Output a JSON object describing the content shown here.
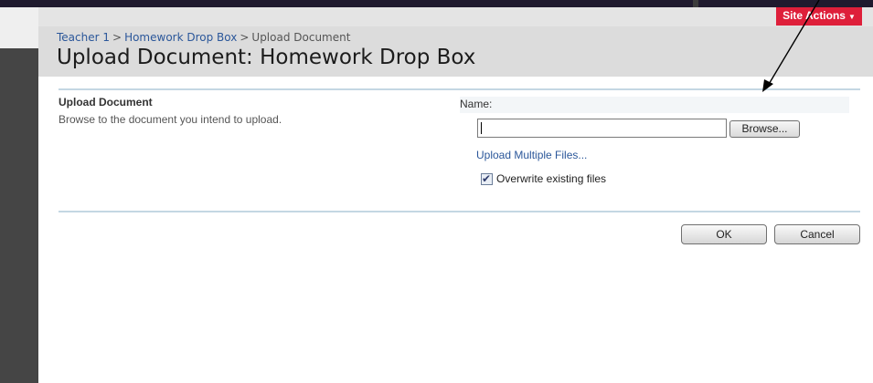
{
  "site_actions": {
    "label": "Site Actions",
    "caret": "▼"
  },
  "breadcrumb": {
    "items": [
      "Teacher 1",
      "Homework Drop Box",
      "Upload Document"
    ],
    "separator": ">"
  },
  "page": {
    "title": "Upload Document: Homework Drop Box"
  },
  "section": {
    "title": "Upload Document",
    "description": "Browse to the document you intend to upload."
  },
  "form": {
    "name_label": "Name:",
    "file_value": "",
    "browse_label": "Browse...",
    "upload_multiple_label": "Upload Multiple Files...",
    "overwrite_label": "Overwrite existing files",
    "overwrite_checked": true
  },
  "actions": {
    "ok_label": "OK",
    "cancel_label": "Cancel"
  },
  "colors": {
    "site_actions_bg": "#de1f3a",
    "link": "#2b579a",
    "rule": "#c4d7e3",
    "header_band": "#dcdcdc"
  },
  "icons": {
    "checkbox": "checkmark-icon",
    "arrow": "annotation-arrow-icon"
  }
}
